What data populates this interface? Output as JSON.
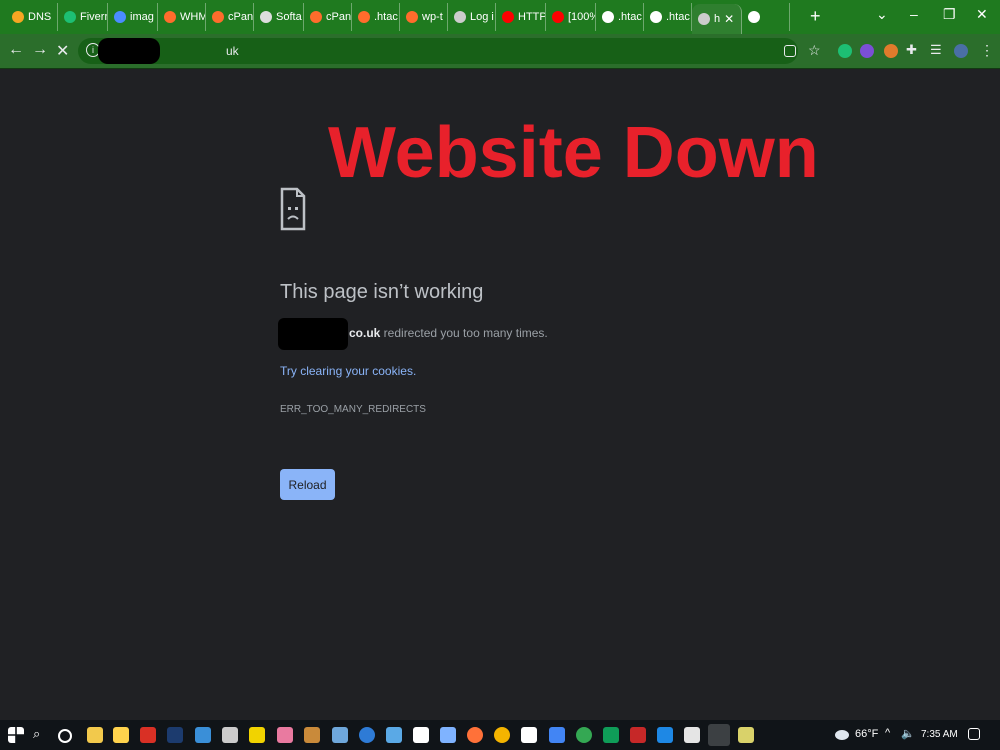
{
  "tabs": [
    {
      "label": "DNS",
      "color": "#f6a623"
    },
    {
      "label": "Fiverr",
      "color": "#1dbf73"
    },
    {
      "label": "imag",
      "color": "#4a8cff"
    },
    {
      "label": "WHM",
      "color": "#ff6c2c"
    },
    {
      "label": "cPan",
      "color": "#ff6c2c"
    },
    {
      "label": "Softa",
      "color": "#dddddd"
    },
    {
      "label": "cPan",
      "color": "#ff6c2c"
    },
    {
      "label": ".htac",
      "color": "#ff6c2c"
    },
    {
      "label": "wp-t",
      "color": "#ff6c2c"
    },
    {
      "label": "Log i",
      "color": "#cccccc"
    },
    {
      "label": "HTTP",
      "color": "#ff0000"
    },
    {
      "label": "[100%",
      "color": "#ff0000"
    },
    {
      "label": ".htac",
      "color": "#ffffff"
    },
    {
      "label": ".htac",
      "color": "#ffffff"
    },
    {
      "label": "h",
      "color": "#cccccc",
      "active": true,
      "close": "✕"
    },
    {
      "label": "",
      "color": "#ffffff"
    }
  ],
  "window": {
    "new_tab": "+",
    "dropdown": "⌄",
    "minimize": "–",
    "maximize": "❐",
    "close": "✕"
  },
  "toolbar": {
    "back": "←",
    "forward": "→",
    "stop": "✕",
    "url_suffix": "uk"
  },
  "headline": "Website Down",
  "error": {
    "title": "This page isn’t working",
    "domain_suffix": "co.uk",
    "message": " redirected you too many times.",
    "link": "Try clearing your cookies.",
    "code": "ERR_TOO_MANY_REDIRECTS",
    "button": "Reload"
  },
  "tray": {
    "temperature": "66°F",
    "time": "7:35 AM"
  },
  "colors": {
    "tab_strip": "#1f7a1f",
    "toolbar": "#2b6e2b",
    "page_bg": "#202124",
    "headline": "#e8212b",
    "link": "#8ab4f8",
    "button": "#8ab4f8"
  }
}
